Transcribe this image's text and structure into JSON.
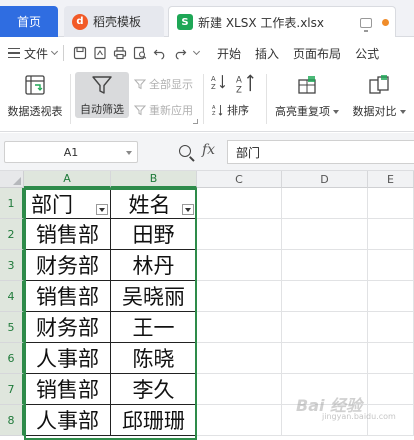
{
  "tabs": {
    "home": "首页",
    "template": "稻壳模板",
    "active": "新建 XLSX 工作表.xlsx",
    "template_icon": "daoke-logo-icon",
    "active_icon": "spreadsheet-icon"
  },
  "menu": {
    "file": "文件",
    "items": [
      "开始",
      "插入",
      "页面布局",
      "公式"
    ]
  },
  "ribbon": {
    "pivot": "数据透视表",
    "autofilter": "自动筛选",
    "show_all": "全部显示",
    "reapply": "重新应用",
    "sort": "排序",
    "highlight_dup": "高亮重复项",
    "compare": "数据对比"
  },
  "formula_bar": {
    "cell_ref": "A1",
    "fx_label": "fx",
    "content": "部门"
  },
  "grid": {
    "columns": [
      "A",
      "B",
      "C",
      "D",
      "E"
    ],
    "rows": [
      "1",
      "2",
      "3",
      "4",
      "5",
      "6",
      "7",
      "8"
    ],
    "table": [
      [
        "部门",
        "姓名"
      ],
      [
        "销售部",
        "田野"
      ],
      [
        "财务部",
        "林丹"
      ],
      [
        "销售部",
        "吴晓丽"
      ],
      [
        "财务部",
        "王一"
      ],
      [
        "人事部",
        "陈晓"
      ],
      [
        "销售部",
        "李久"
      ],
      [
        "人事部",
        "邱珊珊"
      ]
    ]
  },
  "watermark": {
    "brand": "Bai 经验",
    "domain": "jingyan.baidu.com"
  },
  "colors": {
    "home_tab": "#2f6de1",
    "selection": "#2e8b4a",
    "spreadsheet_brand": "#1ea756"
  }
}
